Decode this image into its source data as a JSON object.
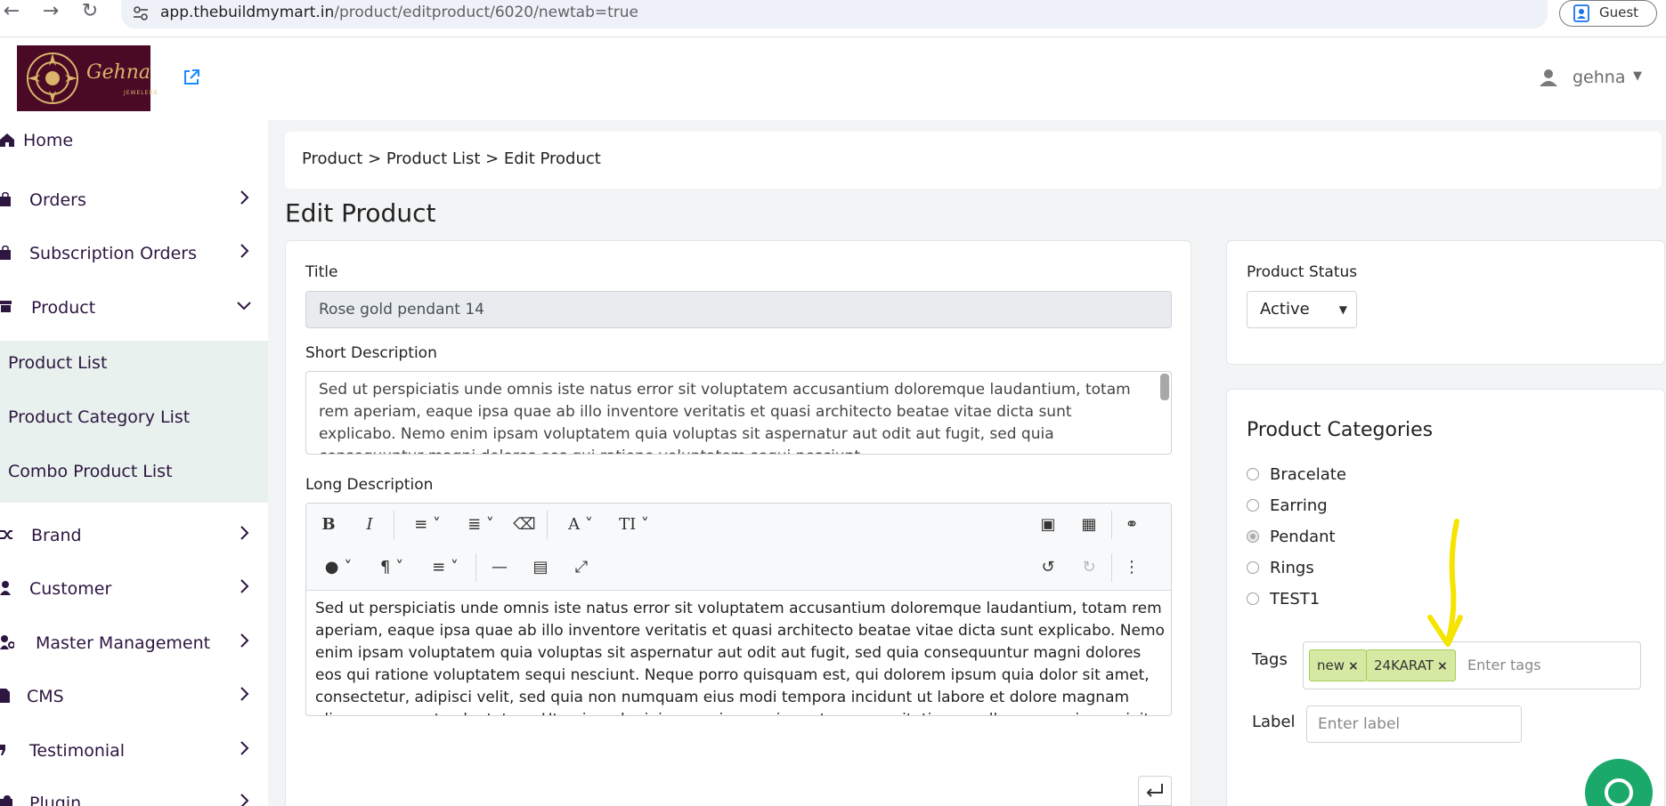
{
  "browser": {
    "url_host": "app.thebuildmymart.in",
    "url_path": "/product/editproduct/6020/newtab=true",
    "guest_label": "Guest"
  },
  "header": {
    "logo_brand": "Gehna",
    "logo_sub": "JEWELERS",
    "user_name": "gehna"
  },
  "sidebar": {
    "items": [
      {
        "label": "Home"
      },
      {
        "label": "Orders"
      },
      {
        "label": "Subscription Orders"
      },
      {
        "label": "Product"
      },
      {
        "label": "Brand"
      },
      {
        "label": "Customer"
      },
      {
        "label": "Master Management"
      },
      {
        "label": "CMS"
      },
      {
        "label": "Testimonial"
      },
      {
        "label": "Plugin"
      }
    ],
    "product_sub": [
      {
        "label": "Product List"
      },
      {
        "label": "Product Category List"
      },
      {
        "label": "Combo Product List"
      }
    ]
  },
  "breadcrumb": "Product > Product List > Edit Product",
  "page_title": "Edit Product",
  "form": {
    "title_label": "Title",
    "title_value": "Rose gold pendant 14",
    "short_desc_label": "Short Description",
    "short_desc_value": "Sed ut perspiciatis unde omnis iste natus error sit voluptatem accusantium doloremque laudantium, totam rem aperiam, eaque ipsa quae ab illo inventore veritatis et quasi architecto beatae vitae dicta sunt explicabo. Nemo enim ipsam voluptatem quia voluptas sit aspernatur aut odit aut fugit, sed quia consequuntur magni dolores eos qui ratione voluptatem sequi nesciunt.",
    "long_desc_label": "Long Description",
    "long_desc_value": "Sed ut perspiciatis unde omnis iste natus error sit voluptatem accusantium doloremque laudantium, totam rem aperiam, eaque ipsa quae ab illo inventore veritatis et quasi architecto beatae vitae dicta sunt explicabo. Nemo enim ipsam voluptatem quia voluptas sit aspernatur aut odit aut fugit, sed quia consequuntur magni dolores eos qui ratione voluptatem sequi nesciunt. Neque porro quisquam est, qui dolorem ipsum quia dolor sit amet, consectetur, adipisci velit, sed quia non numquam eius modi tempora incidunt ut labore et dolore magnam aliquam quaerat voluptatem. Ut enim ad minima veniam, quis nostrum exercitationem ullam corporis suscipit laboriosam, nisi ut aliquid ex ea commodi consequatur? Quis autem vel eum iure reprehenderit qui in ea voluptate velit esse quam nihil molestiae consequatur, vel illum qui dolorem eum fugiat quo voluptas nulla pariatur?\""
  },
  "status": {
    "label": "Product Status",
    "selected": "Active"
  },
  "categories": {
    "title": "Product Categories",
    "options": [
      {
        "label": "Bracelate",
        "checked": false
      },
      {
        "label": "Earring",
        "checked": false
      },
      {
        "label": "Pendant",
        "checked": true
      },
      {
        "label": "Rings",
        "checked": false
      },
      {
        "label": "TEST1",
        "checked": false
      }
    ]
  },
  "tags": {
    "label": "Tags",
    "items": [
      "new",
      "24KARAT"
    ],
    "placeholder": "Enter tags"
  },
  "label_field": {
    "label": "Label",
    "placeholder": "Enter label"
  },
  "colors": {
    "sidebar_sub_bg": "#e8f1ee",
    "logo_bg": "#4a0a25",
    "tag_bg": "#d5e9a2",
    "annotation_arrow": "#f5e400",
    "chat": "#1aa86b"
  }
}
